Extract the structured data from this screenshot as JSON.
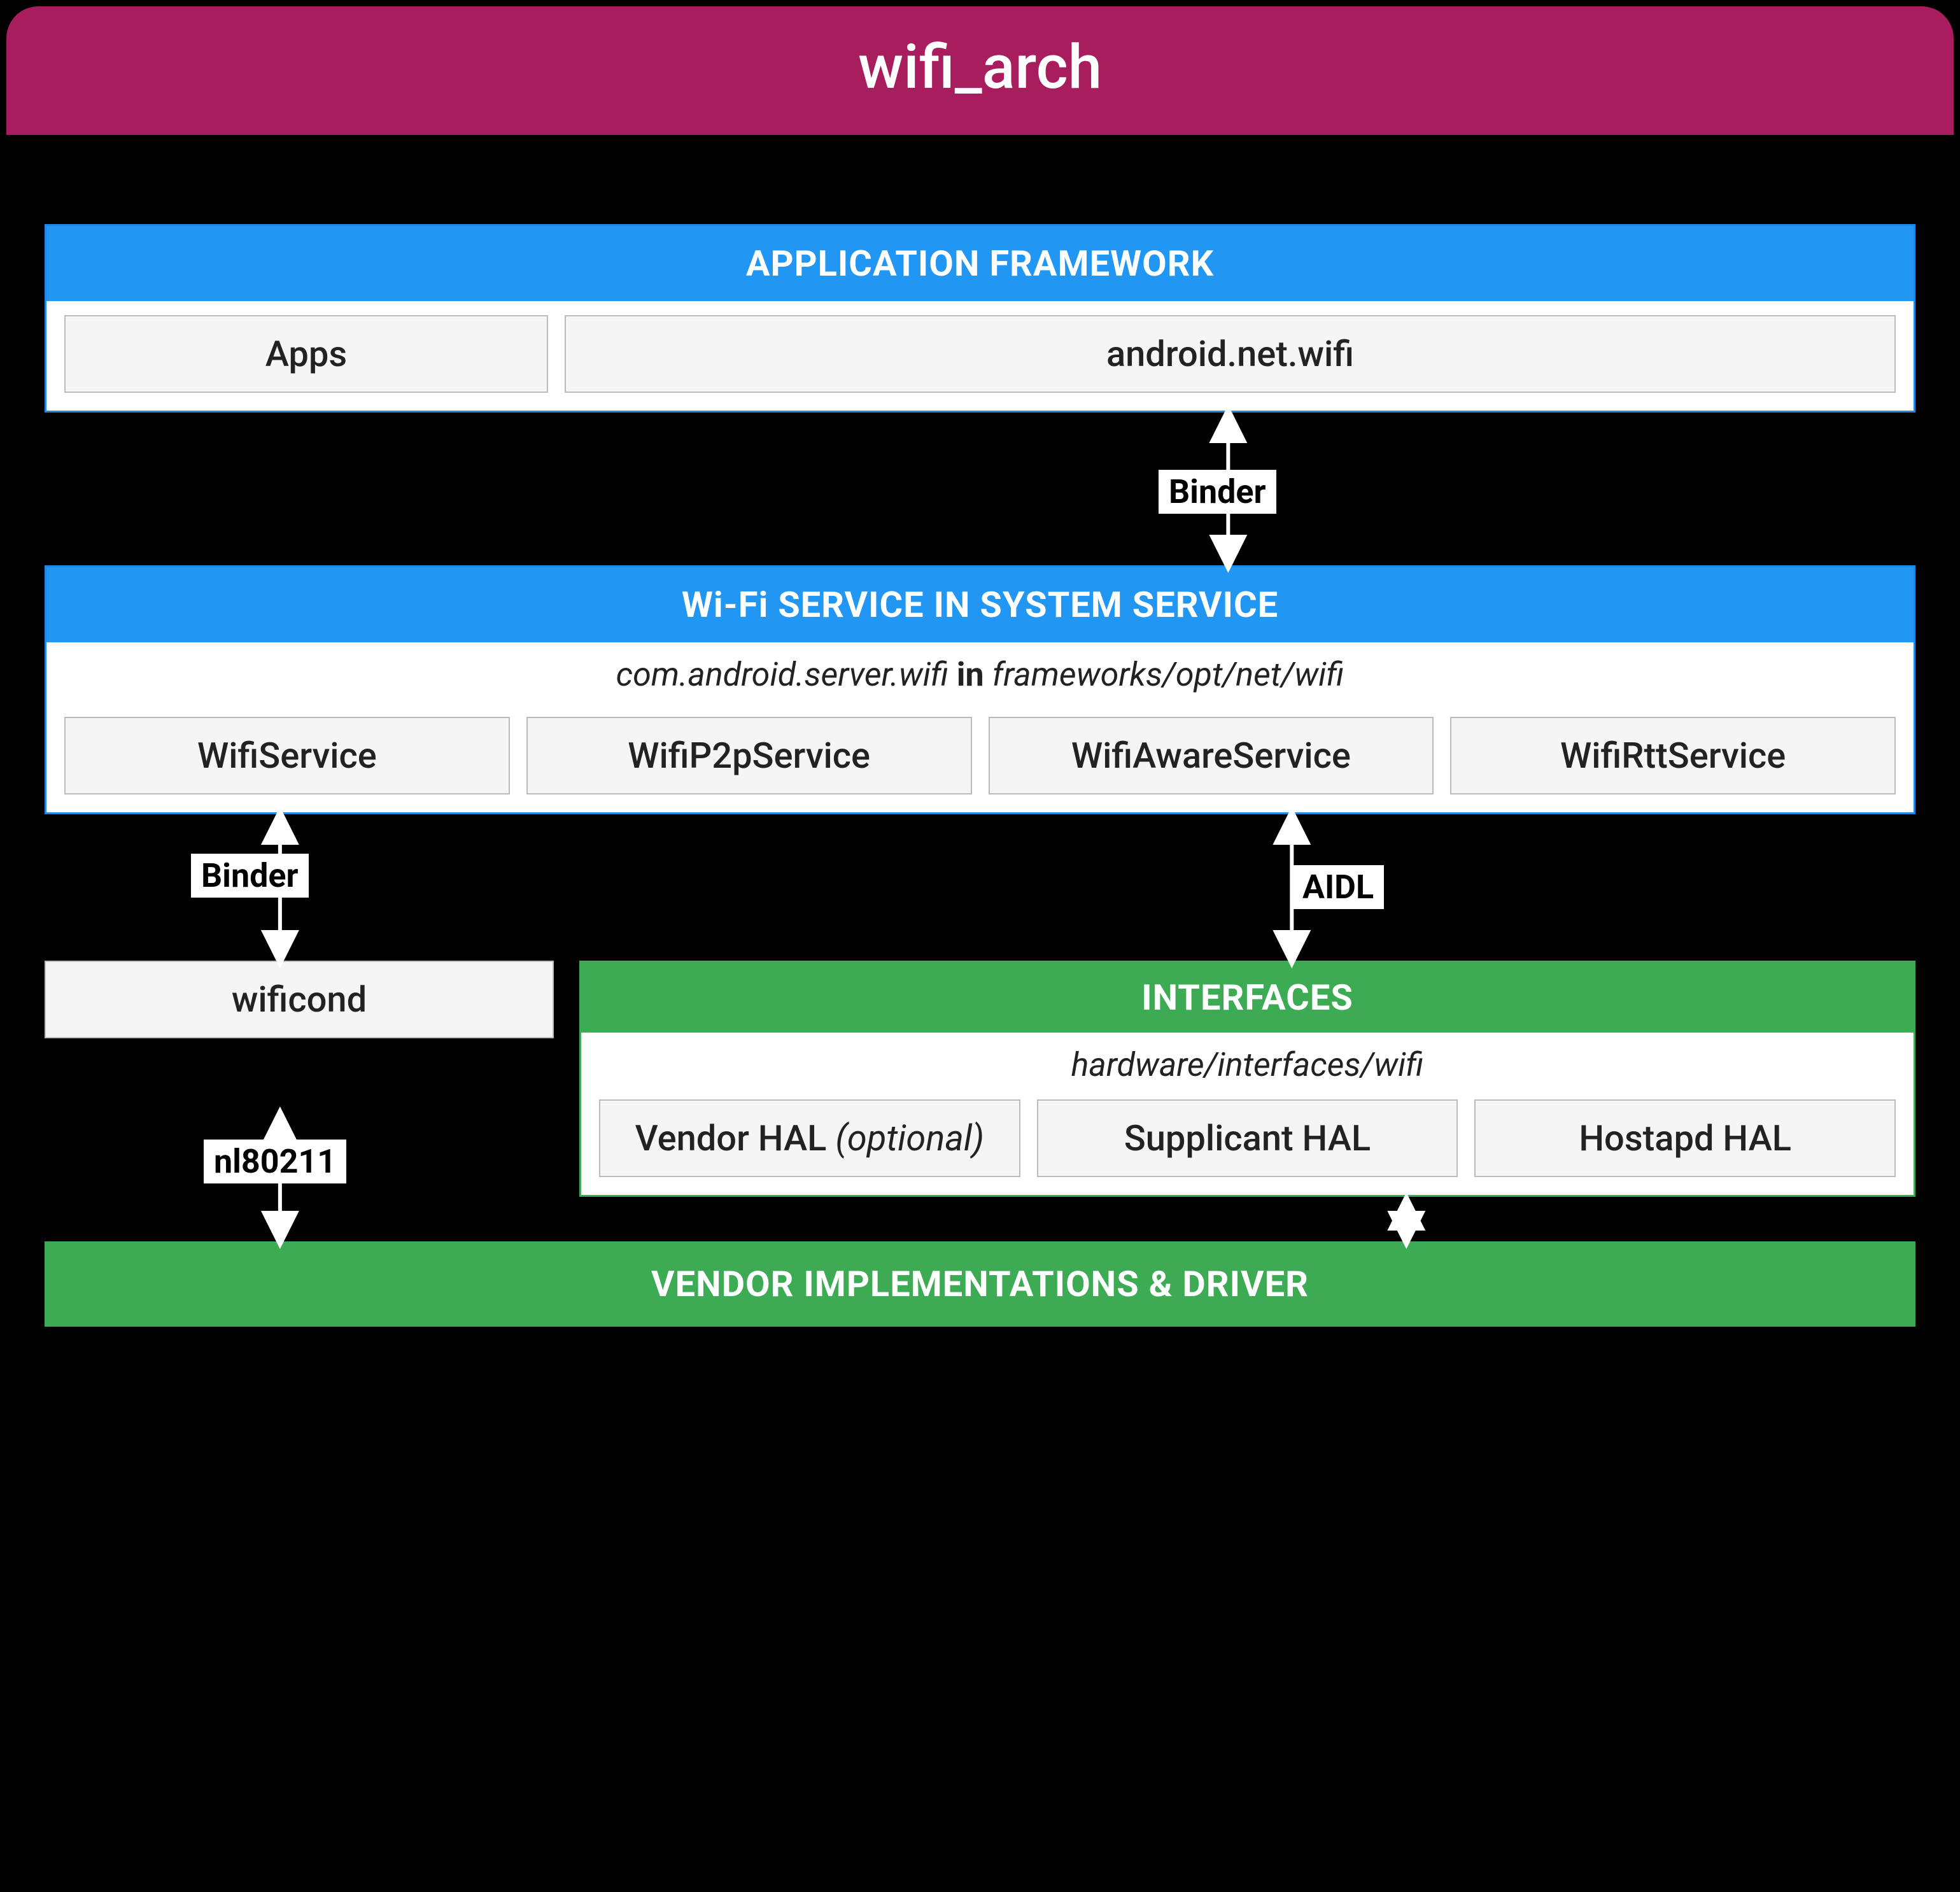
{
  "title": "wifi_arch",
  "layers": {
    "app_framework": {
      "header": "APPLICATION FRAMEWORK",
      "boxes": {
        "apps": "Apps",
        "api": "android.net.wifi"
      }
    },
    "system_service": {
      "header": "Wi-Fi SERVICE IN SYSTEM SERVICE",
      "sub_pkg": "com.android.server.wifi",
      "sub_join": "in",
      "sub_path": "frameworks/opt/net/wifi",
      "boxes": {
        "wifi": "WifiService",
        "p2p": "WifiP2pService",
        "aware": "WifiAwareService",
        "rtt": "WifiRttService"
      }
    },
    "wificond": "wificond",
    "interfaces": {
      "header": "INTERFACES",
      "sub": "hardware/interfaces/wifi",
      "boxes": {
        "vendor_hal": "Vendor HAL",
        "vendor_hal_note": "(optional)",
        "supplicant": "Supplicant HAL",
        "hostapd": "Hostapd HAL"
      }
    },
    "vendor_driver": "VENDOR IMPLEMENTATIONS & DRIVER"
  },
  "connectors": {
    "binder1": "Binder",
    "binder2": "Binder",
    "aidl": "AIDL",
    "nl80211": "nl80211"
  }
}
